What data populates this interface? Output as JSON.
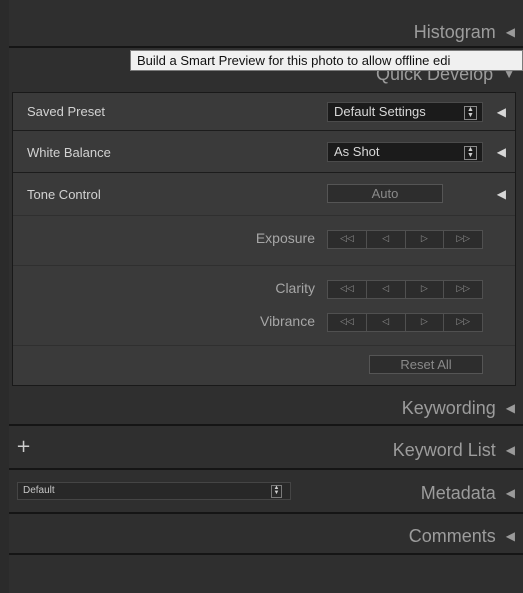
{
  "panels": {
    "histogram": "Histogram",
    "quick_develop": "Quick Develop",
    "keywording": "Keywording",
    "keyword_list": "Keyword List",
    "metadata": "Metadata",
    "comments": "Comments"
  },
  "tooltip": {
    "text": "Build a Smart Preview for this photo to allow offline edi"
  },
  "quick_develop": {
    "saved_preset": {
      "label": "Saved Preset",
      "value": "Default Settings"
    },
    "white_balance": {
      "label": "White Balance",
      "value": "As Shot"
    },
    "tone_control": {
      "label": "Tone Control",
      "auto_label": "Auto"
    },
    "exposure": {
      "label": "Exposure"
    },
    "clarity": {
      "label": "Clarity"
    },
    "vibrance": {
      "label": "Vibrance"
    },
    "reset_all": "Reset All",
    "stepper_glyphs": [
      "◁◁",
      "◁",
      "▷",
      "▷▷"
    ]
  },
  "keyword_list": {
    "add_glyph": "+"
  },
  "metadata": {
    "preset_value": "Default"
  },
  "icons": {
    "collapse": "triangle-left-icon",
    "expand": "triangle-down-icon"
  },
  "colors": {
    "background": "#2b2b2b",
    "panel_body": "#3a3a3a",
    "tooltip_bg": "#f0f0f0"
  }
}
